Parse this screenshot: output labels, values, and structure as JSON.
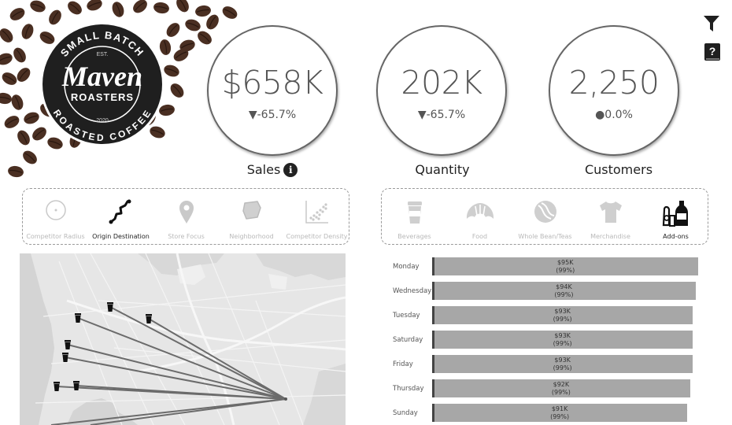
{
  "logo": {
    "top_arc": "SMALL BATCH",
    "est": "EST.",
    "brand": "Maven",
    "sub": "ROASTERS",
    "year": "2020",
    "bottom_arc": "ROASTED COFFEE"
  },
  "toolbar": {
    "filter_icon": "filter-icon",
    "help_icon": "help-icon",
    "help_glyph": "?"
  },
  "kpis": [
    {
      "value": "$658K",
      "change": "▼-65.7%",
      "label": "Sales",
      "info": "i"
    },
    {
      "value": "202K",
      "change": "▼-65.7%",
      "label": "Quantity"
    },
    {
      "value": "2,250",
      "change": "●0.0%",
      "label": "Customers"
    }
  ],
  "map_views": [
    {
      "label": "Competitor Radius",
      "icon": "radius-icon",
      "active": false
    },
    {
      "label": "Origin Destination",
      "icon": "route-icon",
      "active": true
    },
    {
      "label": "Store Focus",
      "icon": "map-pin-icon",
      "active": false
    },
    {
      "label": "Neighborhood",
      "icon": "neighborhood-icon",
      "active": false
    },
    {
      "label": "Competitor Density",
      "icon": "scatter-icon",
      "active": false
    }
  ],
  "categories": [
    {
      "label": "Beverages",
      "icon": "cup-icon",
      "active": false
    },
    {
      "label": "Food",
      "icon": "croissant-icon",
      "active": false
    },
    {
      "label": "Whole Bean/Teas",
      "icon": "bean-icon",
      "active": false
    },
    {
      "label": "Merchandise",
      "icon": "tshirt-icon",
      "active": false
    },
    {
      "label": "Add-ons",
      "icon": "bottle-icon",
      "active": true
    }
  ],
  "colors": {
    "bar": "#a7a7a7",
    "bar_edge": "#444444",
    "map_bg": "#e4e4e4",
    "route": "#666666"
  },
  "chart_data": {
    "type": "bar",
    "orientation": "horizontal",
    "categories": [
      "Monday",
      "Wednesday",
      "Tuesday",
      "Saturday",
      "Friday",
      "Thursday",
      "Sunday"
    ],
    "values": [
      95,
      94,
      93,
      93,
      93,
      92,
      91
    ],
    "value_labels": [
      "$95K",
      "$94K",
      "$93K",
      "$93K",
      "$93K",
      "$92K",
      "$91K"
    ],
    "pct_labels": [
      "(99%)",
      "(99%)",
      "(99%)",
      "(99%)",
      "(99%)",
      "(99%)",
      "(99%)"
    ],
    "unit": "$K",
    "xlim": [
      0,
      96
    ]
  }
}
